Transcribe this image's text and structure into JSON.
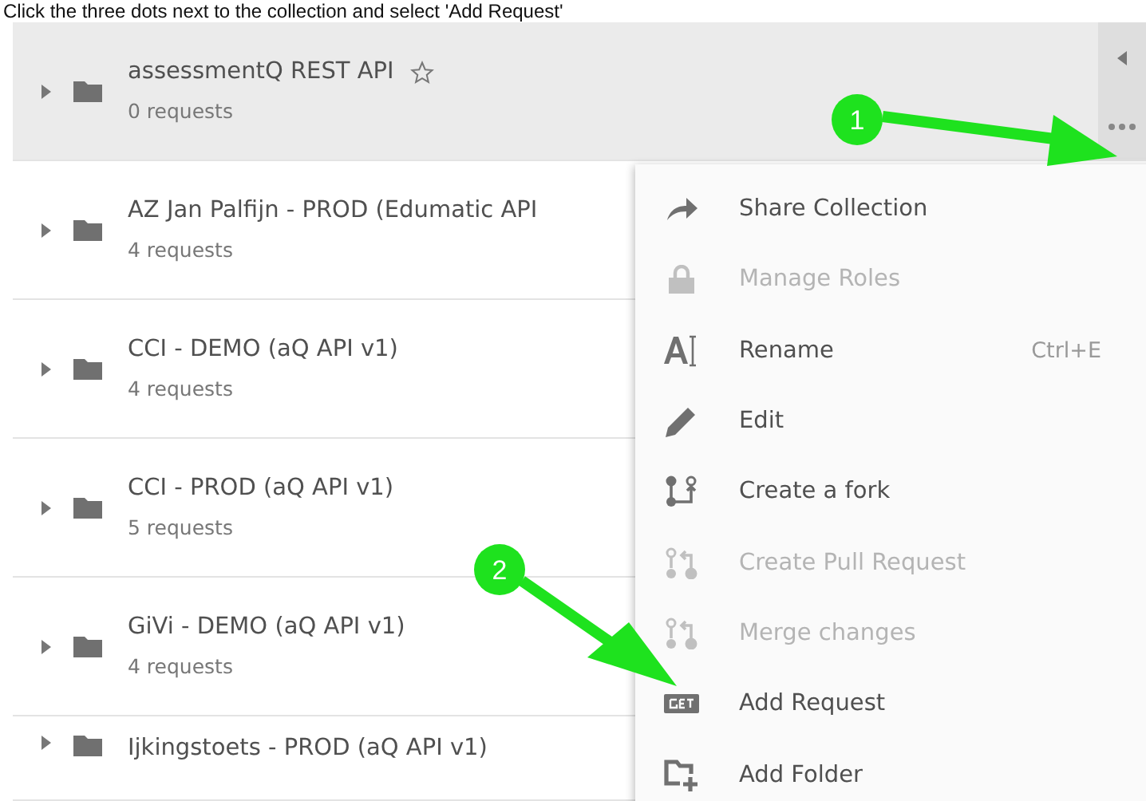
{
  "instruction": "Click the three dots next to the collection and select 'Add Request'",
  "collections": [
    {
      "name": "assessmentQ REST API",
      "count": "0 requests",
      "selected": true
    },
    {
      "name": "AZ Jan Palfijn - PROD (Edumatic API",
      "count": "4 requests",
      "selected": false
    },
    {
      "name": "CCI - DEMO (aQ API v1)",
      "count": "4 requests",
      "selected": false
    },
    {
      "name": "CCI - PROD (aQ API v1)",
      "count": "5 requests",
      "selected": false
    },
    {
      "name": "GiVi - DEMO (aQ API v1)",
      "count": "4 requests",
      "selected": false
    },
    {
      "name": "Ijkingstoets - PROD (aQ API v1)",
      "selected": false
    }
  ],
  "menu": [
    {
      "label": "Share Collection",
      "kind": "share",
      "disabled": false
    },
    {
      "label": "Manage Roles",
      "kind": "lock",
      "disabled": true
    },
    {
      "label": "Rename",
      "kind": "rename",
      "disabled": false,
      "shortcut": "Ctrl+E"
    },
    {
      "label": "Edit",
      "kind": "edit",
      "disabled": false
    },
    {
      "label": "Create a fork",
      "kind": "fork",
      "disabled": false
    },
    {
      "label": "Create Pull Request",
      "kind": "pull",
      "disabled": true
    },
    {
      "label": "Merge changes",
      "kind": "merge",
      "disabled": true
    },
    {
      "label": "Add Request",
      "kind": "request",
      "disabled": false
    },
    {
      "label": "Add Folder",
      "kind": "folder",
      "disabled": false
    }
  ],
  "callouts": [
    "1",
    "2"
  ]
}
